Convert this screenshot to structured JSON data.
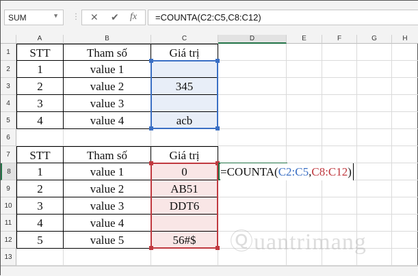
{
  "name_box": "SUM",
  "formula_bar": "=COUNTA(C2:C5,C8:C12)",
  "columns": [
    "A",
    "B",
    "C",
    "D",
    "E",
    "F",
    "G",
    "H"
  ],
  "rows": [
    "1",
    "2",
    "3",
    "4",
    "5",
    "6",
    "7",
    "8",
    "9",
    "10",
    "11",
    "12",
    "13"
  ],
  "table1": {
    "headers": [
      "STT",
      "Tham số",
      "Giá trị"
    ],
    "rows": [
      [
        "1",
        "value 1",
        ""
      ],
      [
        "2",
        "value 2",
        "345"
      ],
      [
        "3",
        "value 3",
        ""
      ],
      [
        "4",
        "value 4",
        "acb"
      ]
    ]
  },
  "table2": {
    "headers": [
      "STT",
      "Tham số",
      "Giá trị"
    ],
    "rows": [
      [
        "1",
        "value 1",
        "0"
      ],
      [
        "2",
        "value 2",
        "AB51"
      ],
      [
        "3",
        "value 3",
        "DDT6"
      ],
      [
        "4",
        "value 4",
        ""
      ],
      [
        "5",
        "value 5",
        "56#$"
      ]
    ]
  },
  "edit_cell": {
    "prefix": "=COUNTA(",
    "ref1": "C2:C5",
    "sep": ",",
    "ref2": "C8:C12",
    "suffix": ")"
  },
  "watermark": "Quantrimang",
  "colors": {
    "ref1": "#3a6fc4",
    "ref2": "#c0393f",
    "active": "#217346"
  }
}
